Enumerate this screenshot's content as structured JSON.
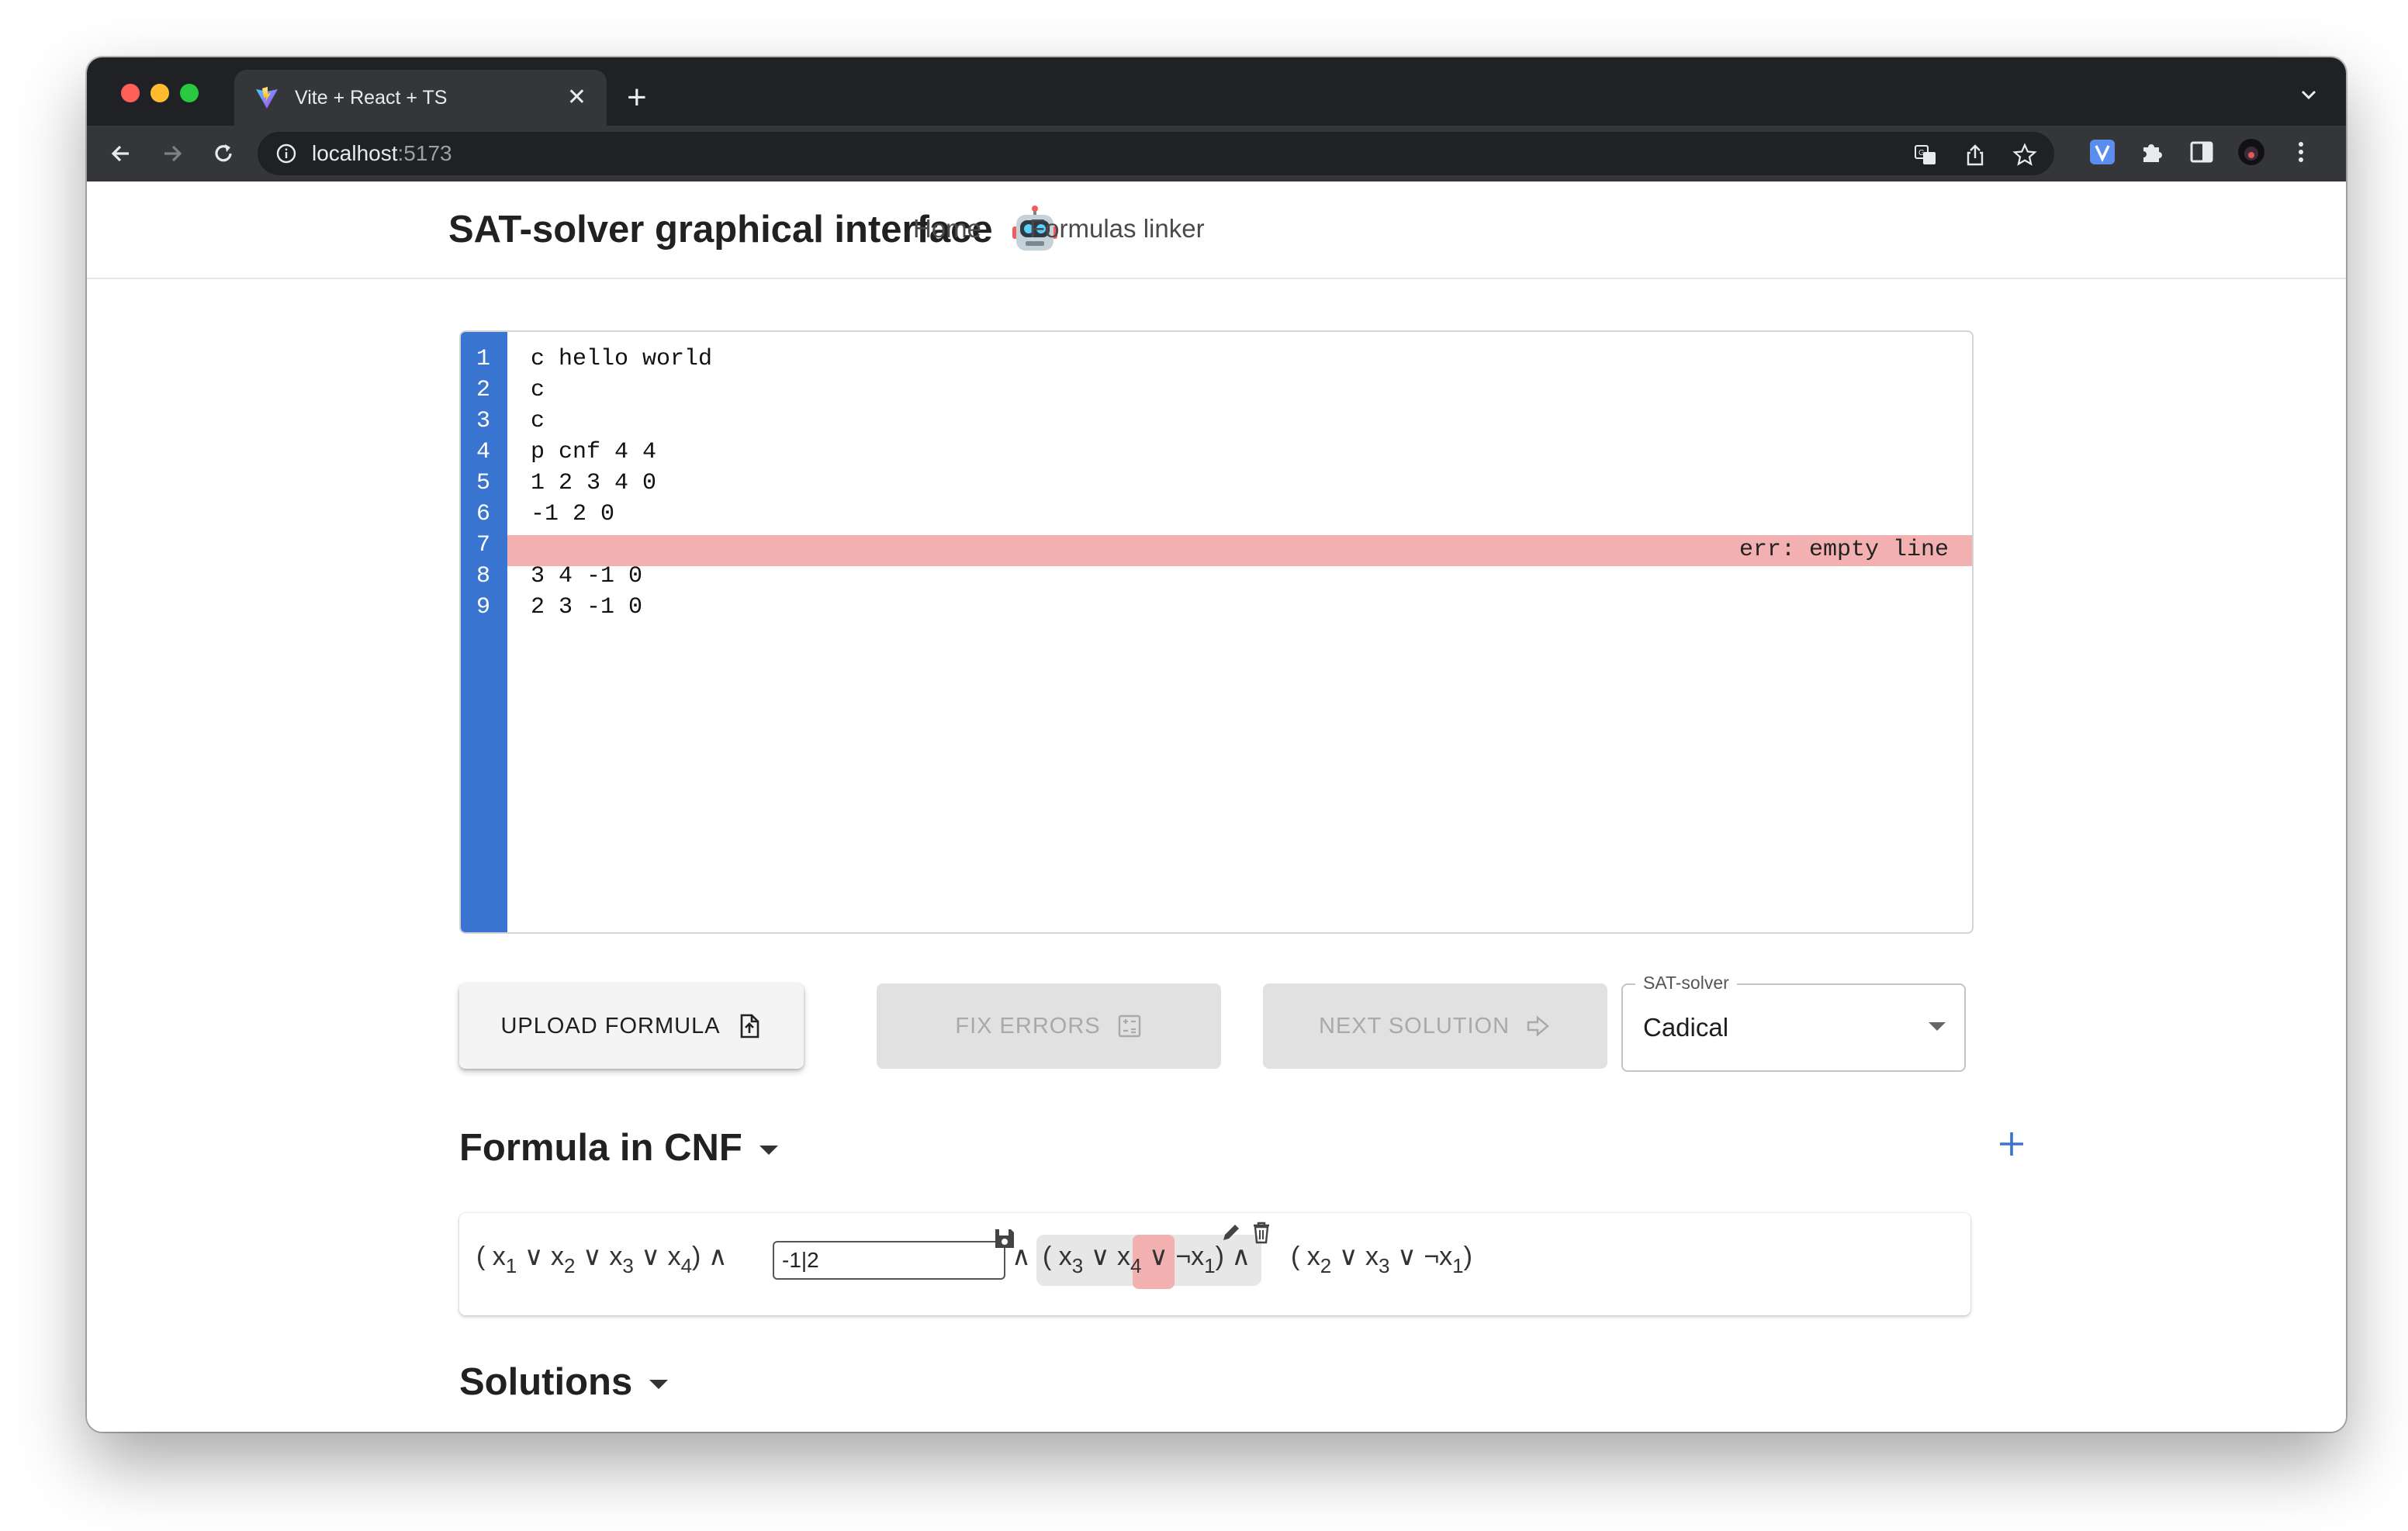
{
  "browser": {
    "tab_title": "Vite + React + TS",
    "url_host": "localhost",
    "url_port": ":5173",
    "colors": {
      "close": "#ff5f57",
      "minimize": "#febc2e",
      "zoom": "#28c840"
    }
  },
  "appbar": {
    "title": "SAT-solver graphical interface",
    "nav": {
      "home": "Home",
      "formulas_linker": "Formulas linker"
    }
  },
  "editor": {
    "line_numbers": [
      "1",
      "2",
      "3",
      "4",
      "5",
      "6",
      "7",
      "8",
      "9"
    ],
    "lines": [
      "c hello world",
      "c",
      "c",
      "p cnf 4 4",
      "1 2 3 4 0",
      "-1 2 0",
      "",
      "3 4 -1 0",
      "2 3 -1 0"
    ],
    "error_message": "err: empty line",
    "error_line": 7,
    "gutter_color": "#3a74d1",
    "error_color": "#f3b0b1"
  },
  "buttons": {
    "upload": "UPLOAD FORMULA",
    "fix_errors": "FIX ERRORS",
    "next_solution": "NEXT SOLUTION"
  },
  "solver_select": {
    "label": "SAT-solver",
    "value": "Cadical"
  },
  "formula": {
    "heading": "Formula in CNF",
    "clause1": {
      "open": "(",
      "close": ")",
      "literals": [
        {
          "v": "x",
          "i": "1"
        },
        {
          "v": "x",
          "i": "2"
        },
        {
          "v": "x",
          "i": "3"
        },
        {
          "v": "x",
          "i": "4"
        }
      ]
    },
    "editing_input_value": "-1|2",
    "clause3": {
      "open": "(",
      "close": ")",
      "literals": [
        {
          "v": "x",
          "i": "3"
        },
        {
          "v": "x",
          "i": "4"
        },
        {
          "v": "¬x",
          "i": "1"
        }
      ]
    },
    "clause4": {
      "open": "(",
      "close": ")",
      "literals": [
        {
          "v": "x",
          "i": "2"
        },
        {
          "v": "x",
          "i": "3"
        },
        {
          "v": "¬x",
          "i": "1"
        }
      ]
    },
    "or_symbol": "∨",
    "and_symbol": "∧"
  },
  "solutions": {
    "heading": "Solutions"
  }
}
